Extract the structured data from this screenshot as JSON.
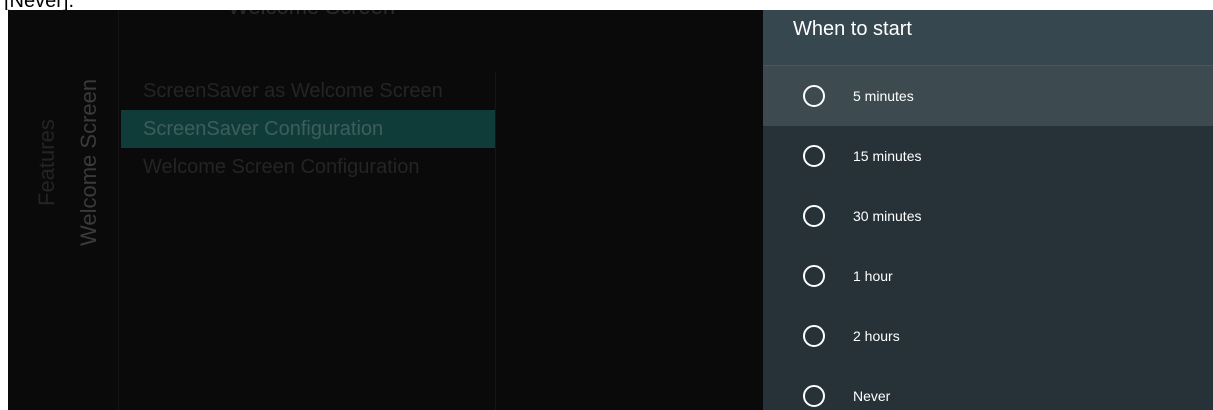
{
  "document_fragment": "[Never].",
  "background": {
    "header_partial": "Welcome Screen",
    "rail_features_label": "Features",
    "rail_welcome_label": "Welcome Screen",
    "menu_items": [
      {
        "label": "ScreenSaver as Welcome Screen",
        "selected": false
      },
      {
        "label": "ScreenSaver Configuration",
        "selected": true
      },
      {
        "label": "Welcome Screen Configuration",
        "selected": false
      }
    ]
  },
  "panel": {
    "title": "When to start",
    "options": [
      {
        "label": "5 minutes",
        "selected": false,
        "focused": true
      },
      {
        "label": "15 minutes",
        "selected": false,
        "focused": false
      },
      {
        "label": "30 minutes",
        "selected": false,
        "focused": false
      },
      {
        "label": "1 hour",
        "selected": false,
        "focused": false
      },
      {
        "label": "2 hours",
        "selected": false,
        "focused": false
      },
      {
        "label": "Never",
        "selected": false,
        "focused": false
      }
    ]
  },
  "colors": {
    "panel_bg": "#263238",
    "panel_header_bg": "#37474f",
    "focused_row_bg": "#3d4a50",
    "selected_menu_bg": "#0f3c39",
    "screen_bg": "#0a0a0a"
  },
  "icons": {
    "radio": "radio-unchecked-icon"
  }
}
